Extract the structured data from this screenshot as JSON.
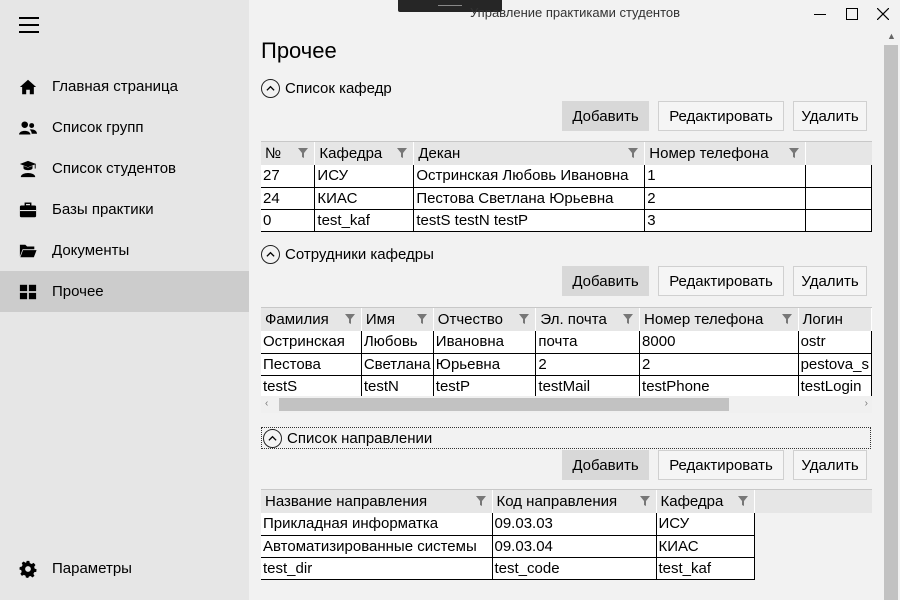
{
  "window": {
    "title": "Управление практиками студентов"
  },
  "sidebar": {
    "items": [
      {
        "label": "Главная страница",
        "icon": "home-icon"
      },
      {
        "label": "Список групп",
        "icon": "users-icon"
      },
      {
        "label": "Список студентов",
        "icon": "graduate-icon"
      },
      {
        "label": "Базы практики",
        "icon": "briefcase-icon"
      },
      {
        "label": "Документы",
        "icon": "folder-icon"
      },
      {
        "label": "Прочее",
        "icon": "grid-icon",
        "active": true
      }
    ],
    "settings": {
      "label": "Параметры",
      "icon": "gear-icon"
    }
  },
  "main": {
    "title": "Прочее",
    "buttons": {
      "add": "Добавить",
      "edit": "Редактировать",
      "delete": "Удалить"
    },
    "departments": {
      "header": "Список кафедр",
      "columns": [
        "№",
        "Кафедра",
        "Декан",
        "Номер телефона"
      ],
      "rows": [
        [
          "27",
          "ИСУ",
          "Остринская Любовь Ивановна",
          "1"
        ],
        [
          "24",
          "КИАС",
          "Пестова Светлана Юрьевна",
          "2"
        ],
        [
          "0",
          "test_kaf",
          "testS testN testP",
          "3"
        ]
      ]
    },
    "staff": {
      "header": "Сотрудники кафедры",
      "columns": [
        "Фамилия",
        "Имя",
        "Отчество",
        "Эл. почта",
        "Номер телефона",
        "Логин"
      ],
      "rows": [
        [
          "Остринская",
          "Любовь",
          "Ивановна",
          "почта",
          "8000",
          "ostr"
        ],
        [
          "Пестова",
          "Светлана",
          "Юрьевна",
          "2",
          "2",
          "pestova_s"
        ],
        [
          "testS",
          "testN",
          "testP",
          "testMail",
          "testPhone",
          "testLogin"
        ]
      ]
    },
    "directions": {
      "header": "Список направлении",
      "columns": [
        "Название направления",
        "Код направления",
        "Кафедра"
      ],
      "rows": [
        [
          "Прикладная информатка",
          "09.03.03",
          "ИСУ"
        ],
        [
          "Автоматизированные системы",
          "09.03.04",
          "КИАС"
        ],
        [
          "test_dir",
          "test_code",
          "test_kaf"
        ]
      ]
    }
  },
  "colors": {
    "sidebar_bg": "#e6e6e6",
    "active_item_bg": "#cccccc",
    "content_bg": "#f2f2f2",
    "header_bg": "#e6e6e6"
  }
}
